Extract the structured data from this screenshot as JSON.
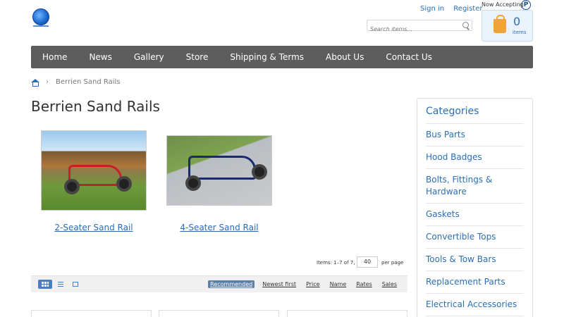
{
  "header": {
    "sign_in": "Sign in",
    "register": "Register",
    "search_placeholder": "Search items...",
    "now_accepting": "Now Accepting",
    "cart_count": "0",
    "cart_items_label": "items"
  },
  "nav": {
    "items": [
      "Home",
      "News",
      "Gallery",
      "Store",
      "Shipping & Terms",
      "About Us",
      "Contact Us"
    ]
  },
  "breadcrumb": {
    "separator": "›",
    "current": "Berrien Sand Rails"
  },
  "page_title": "Berrien Sand Rails",
  "products": [
    {
      "name": "2-Seater Sand Rail"
    },
    {
      "name": "4-Seater Sand Rail"
    }
  ],
  "pagination": {
    "items_info": "Items: 1–7 of 7,",
    "per_page_value": "40",
    "per_page_label": "per page"
  },
  "sort": {
    "options": [
      "Recommended",
      "Newest first",
      "Price",
      "Name",
      "Rates",
      "Sales"
    ],
    "active": "Recommended"
  },
  "sidebar": {
    "title": "Categories",
    "categories": [
      "Bus Parts",
      "Hood Badges",
      "Bolts, Fittings & Hardware",
      "Gaskets",
      "Convertible Tops",
      "Tools & Tow Bars",
      "Replacement Parts",
      "Electrical Accessories"
    ]
  },
  "colors": {
    "accent": "#2a6fb5",
    "nav_bg": "#5d5d5d",
    "active_sort": "#5a7fa8"
  }
}
